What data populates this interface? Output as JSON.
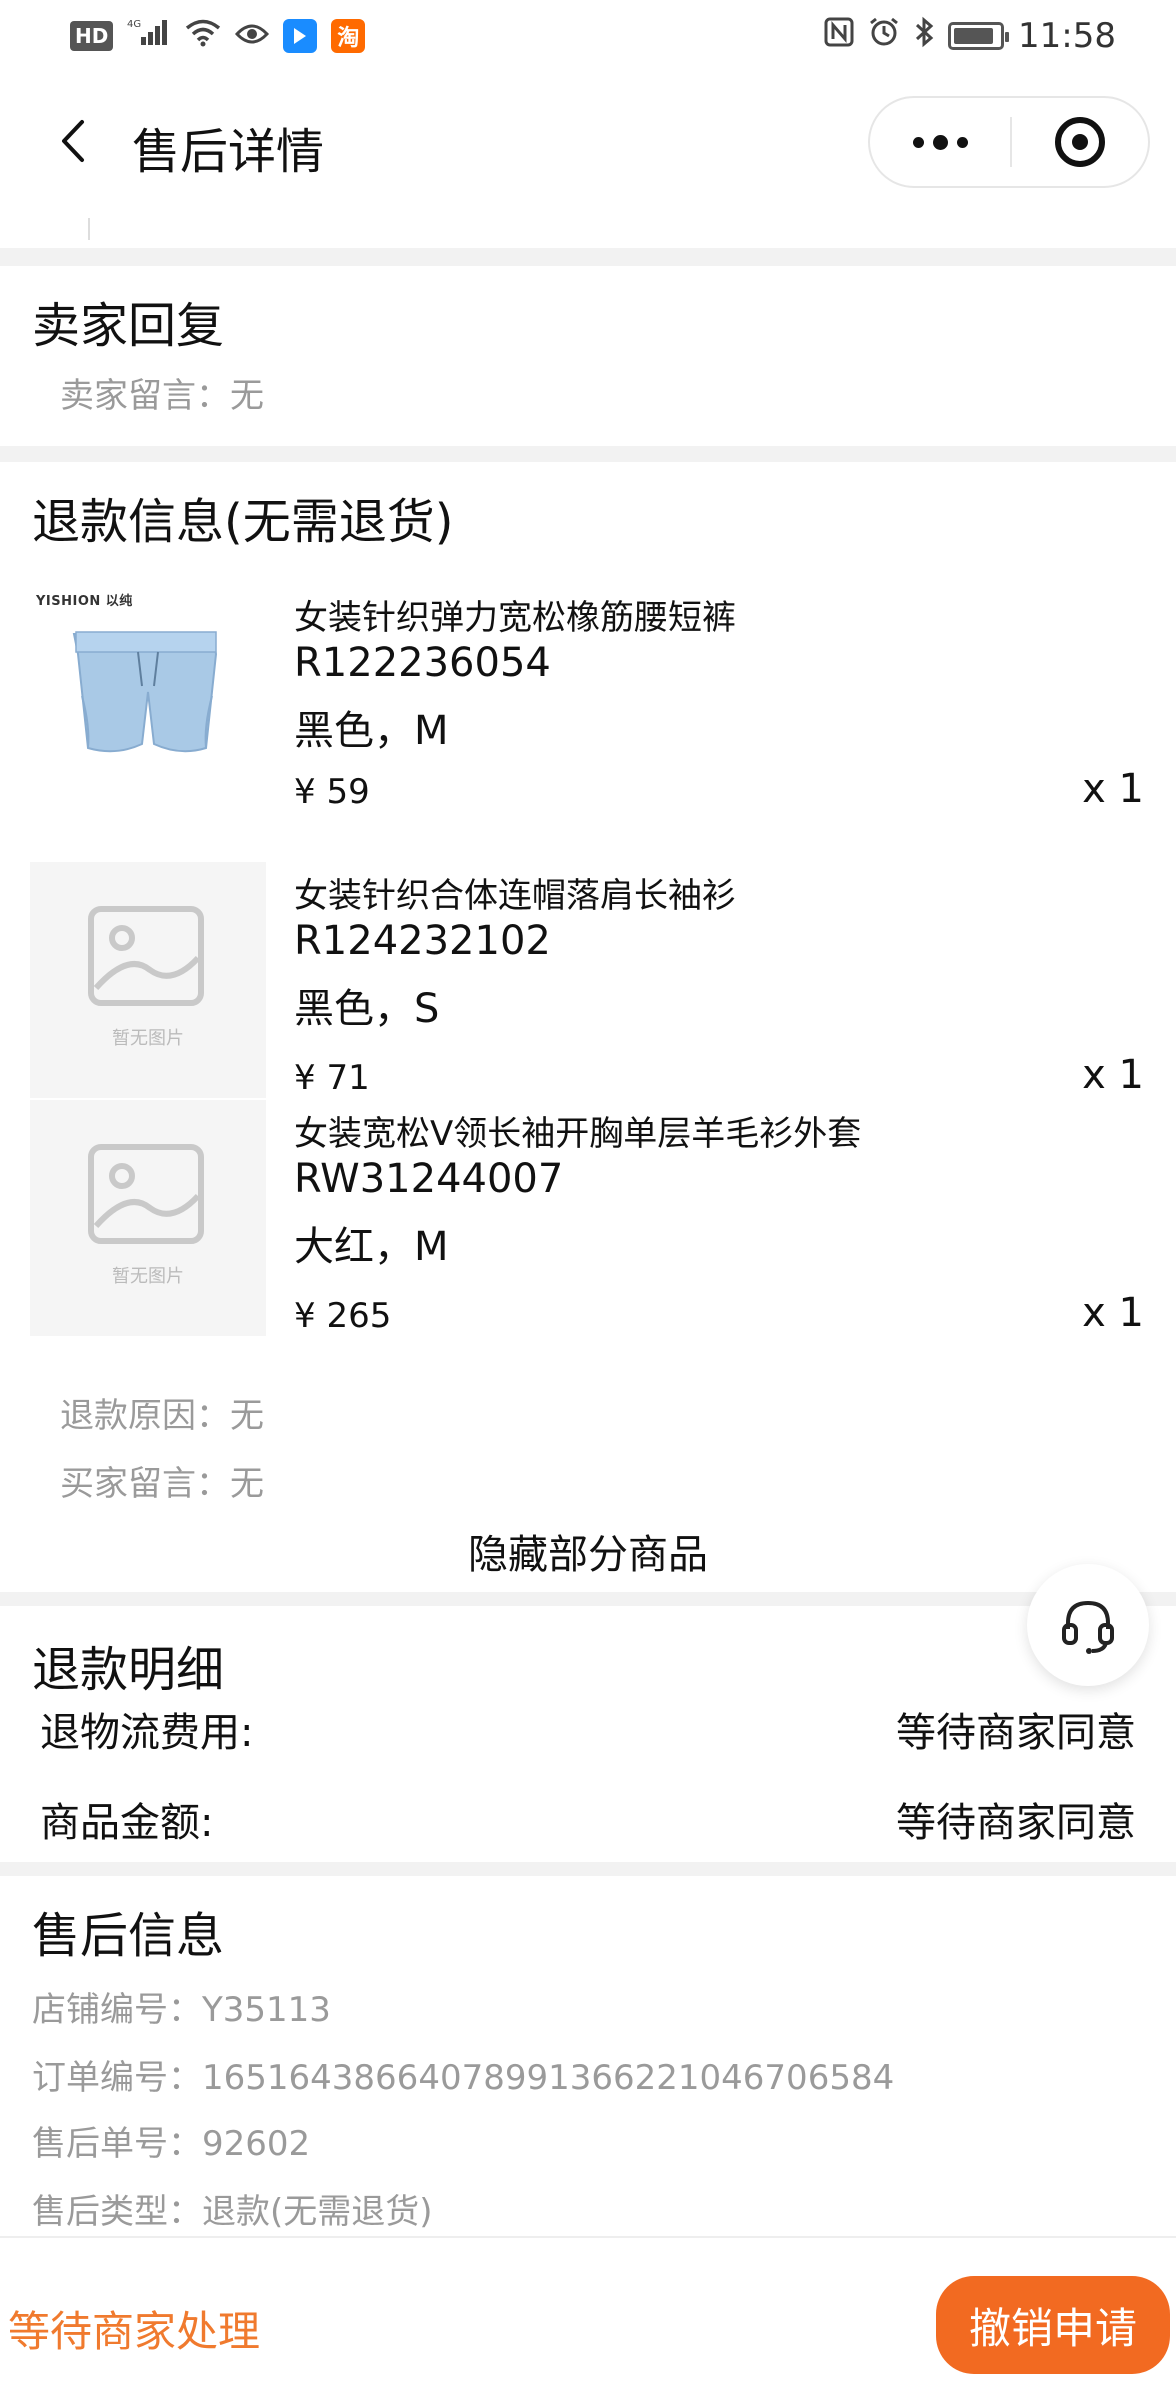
{
  "status_bar": {
    "time": "11:58",
    "network": "4G",
    "hd": "HD",
    "app2": "淘"
  },
  "nav": {
    "title": "售后详情"
  },
  "seller_reply": {
    "title": "卖家回复",
    "message": "卖家留言：无"
  },
  "refund_info": {
    "title": "退款信息(无需退货)",
    "products": [
      {
        "name": "女装针织弹力宽松橡筋腰短裤",
        "code": "R122236054",
        "spec": "黑色，M",
        "price": "¥ 59",
        "qty": "x 1",
        "brand": "YISHION 以纯"
      },
      {
        "name": "女装针织合体连帽落肩长袖衫",
        "code": "R124232102",
        "spec": "黑色，S",
        "price": "¥ 71",
        "qty": "x 1",
        "placeholder": "暂无图片"
      },
      {
        "name": "女装宽松V领长袖开胸单层羊毛衫外套",
        "code": "RW31244007",
        "spec": "大红，M",
        "price": "¥ 265",
        "qty": "x 1",
        "placeholder": "暂无图片"
      }
    ],
    "reason": "退款原因：无",
    "buyer_message": "买家留言：无",
    "toggle": "隐藏部分商品"
  },
  "refund_detail": {
    "title": "退款明细",
    "rows": [
      {
        "label": "退物流费用:",
        "value": "等待商家同意"
      },
      {
        "label": "商品金额:",
        "value": "等待商家同意"
      }
    ]
  },
  "aftersale_info": {
    "title": "售后信息",
    "lines": [
      "店铺编号：Y35113",
      "订单编号：1651643866407899136622104670658​4",
      "售后单号：92602",
      "售后类型：退款(无需退货)"
    ]
  },
  "bottom": {
    "status": "等待商家处理",
    "cancel": "撤销申请"
  },
  "colors": {
    "accent": "#f26a21",
    "status_text": "#f07a2e",
    "secondary_text": "#9a9a9a"
  }
}
